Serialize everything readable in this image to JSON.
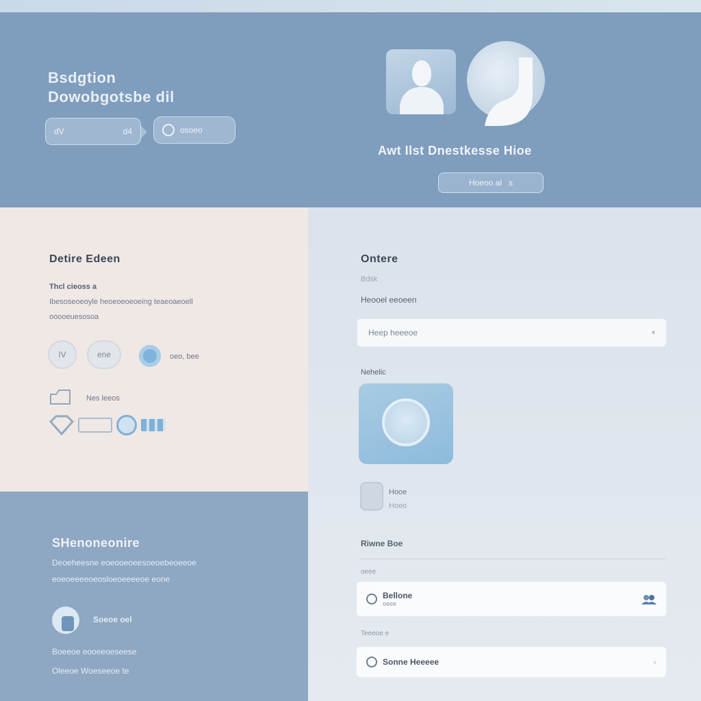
{
  "hero": {
    "title_line1": "Bsdgtion",
    "title_line2": "Dowobgotsbe dil",
    "pill_primary": {
      "left_text": "dV",
      "right_text": "d4"
    },
    "pill_secondary": {
      "text": "osoeo"
    },
    "caption": "Awt Ilst Dnestkesse Hioe",
    "button": {
      "text": "Hoeoo al",
      "suffix": "s"
    }
  },
  "left_panel": {
    "heading": "Detire Edeen",
    "subheading": "Thcl cieoss a",
    "body_line1": "Ibesoseoeoyle heoeoeoeoeing teaeoaeoell",
    "body_line2": "ooooeuesosoa",
    "chip_1": "IV",
    "chip_2": "ene",
    "dot_label": "oeo, bee",
    "row_label": "Nes leeos"
  },
  "lower_left": {
    "heading": "SHenoneonire",
    "body_line1": "Deoeheesne eoeooeoeesoeoebeoeeoe",
    "body_line2": "eoeoeeeeoeosloeoeeeeoe eone",
    "user_label": "Soeoe oel",
    "footer_line1": "Boeeoe eooeeoeseese",
    "footer_line2": "Oleeoe Woeseeoe te"
  },
  "right_panel": {
    "heading": "Ontere",
    "label_small": "Bdsk",
    "field_label": "Heooel eeoeen",
    "field_value": "Heep heeeoe",
    "field_chevron": "▾",
    "media_label": "Nehelic",
    "mini_line1": "Hooe",
    "mini_line2": "Hoeo",
    "section_title": "Riwne Boe",
    "row1_label": "oeee",
    "row1_title": "Bellone",
    "row1_sub": "oeee",
    "row2_label": "Teeeoe e",
    "row2_title": "Sonne Heeeee",
    "row2_end": "◦"
  },
  "colors": {
    "hero_bg": "#7f9dbd",
    "beige_bg": "#f0e8e5",
    "blue_panel_bg": "#8ea7c2",
    "right_bg": "#dbe2ea",
    "accent": "#7fb3d8"
  },
  "icons": [
    "user-avatar-icon",
    "hook-logo-icon",
    "diamond-icon",
    "circle-icon",
    "image-icon",
    "ring-icon",
    "user-icon"
  ]
}
